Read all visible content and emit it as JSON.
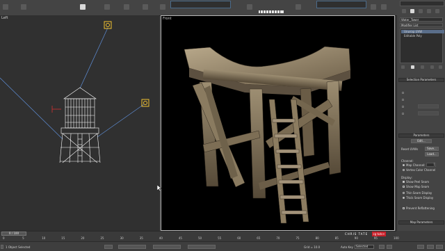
{
  "toolbar": {
    "icons": [
      "select-icon",
      "move-icon",
      "rotate-icon",
      "scale-icon",
      "snap-icon",
      "render-icon"
    ],
    "active_marker": ""
  },
  "viewports": {
    "left_label": "Left",
    "right_label": "Front"
  },
  "command_panel": {
    "object_name": "Water_Tower",
    "modifier_list_label": "Modifier List",
    "stack": [
      {
        "label": "Unwrap UVW",
        "selected": true
      },
      {
        "label": "Editable Poly",
        "selected": false
      }
    ],
    "rollouts": {
      "selection": "Selection Parameters",
      "parameters": "Parameters",
      "map_params": "Map Parameters"
    },
    "edit_button": "Edit...",
    "reset_uvws": "Reset UVWs",
    "save_button": "Save...",
    "load_button": "Load...",
    "channel_label": "Channel:",
    "map_channel_label": "Map Channel:",
    "map_channel_value": "1",
    "vertex_color_label": "Vertex Color Channel",
    "display_label": "Display:",
    "show_peel_seam": "Show Peel Seam",
    "show_map_seam": "Show Map Seam",
    "thin_seam": "Thin Seam Display",
    "thick_seam": "Thick Seam Display",
    "prevent_reflattening": "Prevent Reflattening"
  },
  "timeline": {
    "slider_label": "0 / 100",
    "ticks": [
      "0",
      "5",
      "10",
      "15",
      "20",
      "25",
      "30",
      "35",
      "40",
      "45",
      "50",
      "55",
      "60",
      "65",
      "70",
      "75",
      "80",
      "85",
      "90",
      "95",
      "100"
    ]
  },
  "status": {
    "selection": "1 Object Selected",
    "grid": "Grid = 10.0",
    "auto_key": "Auto Key",
    "selected_dropdown": "Selected"
  },
  "watermark": {
    "text": "CHRIS TATE",
    "badge": "cg tuts+"
  },
  "colors": {
    "viewport_bg_left": "#303030",
    "viewport_bg_right": "#000000",
    "light_icon": "#f2c230",
    "wireframe": "#ffffff",
    "camera_line": "#5f8fd8"
  }
}
